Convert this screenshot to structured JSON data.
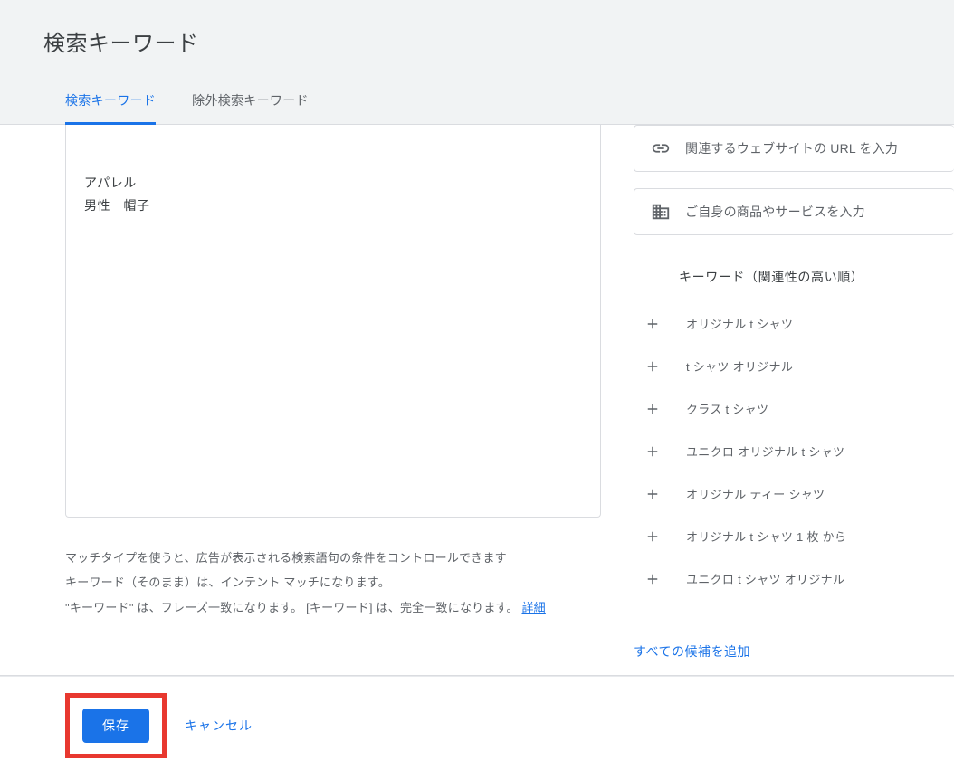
{
  "header": {
    "title": "検索キーワード"
  },
  "tabs": {
    "search": "検索キーワード",
    "negative": "除外検索キーワード"
  },
  "keywords": {
    "value": "アパレル\n男性　帽子"
  },
  "help": {
    "line1": "マッチタイプを使うと、広告が表示される検索語句の条件をコントロールできます",
    "line2": "キーワード（そのまま）は、インテント マッチになります。",
    "line3": "\"キーワード\" は、フレーズ一致になります。  [キーワード] は、完全一致になります。",
    "link_label": "詳細"
  },
  "footer": {
    "save_label": "保存",
    "cancel_label": "キャンセル"
  },
  "right_panel": {
    "url_placeholder": "関連するウェブサイトの URL を入力",
    "product_placeholder": "ご自身の商品やサービスを入力",
    "suggestions_title": "キーワード（関連性の高い順）",
    "add_all_label": "すべての候補を追加",
    "suggestions": [
      "オリジナル t シャツ",
      "t シャツ オリジナル",
      "クラス t シャツ",
      "ユニクロ オリジナル t シャツ",
      "オリジナル ティー シャツ",
      "オリジナル t シャツ 1 枚 から",
      "ユニクロ t シャツ オリジナル"
    ]
  }
}
